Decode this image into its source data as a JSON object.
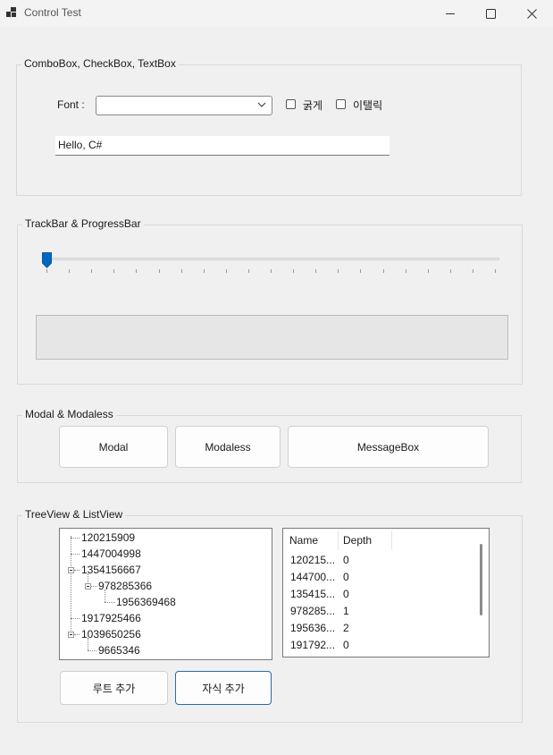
{
  "window": {
    "title": "Control Test"
  },
  "group1": {
    "title": "ComboBox, CheckBox, TextBox",
    "font_label": "Font :",
    "combo_value": "",
    "bold_label": "굵게",
    "italic_label": "이탤릭",
    "textbox_value": "Hello, C#"
  },
  "group2": {
    "title": "TrackBar & ProgressBar",
    "trackbar_value": 0,
    "progress_value": 0
  },
  "group3": {
    "title": "Modal & Modaless",
    "modal_label": "Modal",
    "modaless_label": "Modaless",
    "messagebox_label": "MessageBox"
  },
  "group4": {
    "title": "TreeView & ListView",
    "tree": [
      "120215909",
      "1447004998",
      "1354156667",
      "978285366",
      "1956369468",
      "1917925466",
      "1039650256",
      "9665346"
    ],
    "list_columns": [
      "Name",
      "Depth"
    ],
    "list_rows": [
      {
        "name": "120215...",
        "depth": "0"
      },
      {
        "name": "144700...",
        "depth": "0"
      },
      {
        "name": "135415...",
        "depth": "0"
      },
      {
        "name": "978285...",
        "depth": "1"
      },
      {
        "name": "195636...",
        "depth": "2"
      },
      {
        "name": "191792...",
        "depth": "0"
      }
    ],
    "add_root_label": "루트 추가",
    "add_child_label": "자식 추가"
  }
}
